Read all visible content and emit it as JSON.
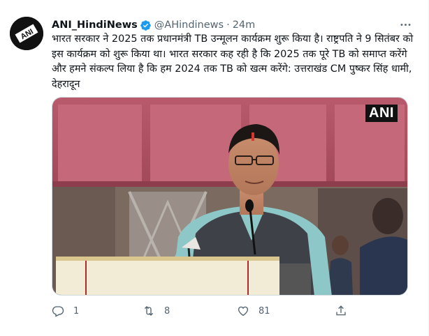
{
  "tweet": {
    "display_name": "ANI_HindiNews",
    "verified_icon": "verified-badge-icon",
    "handle": "@AHindinews",
    "separator": "·",
    "time": "24m",
    "more_icon": "more-options-icon",
    "text": "भारत सरकार ने 2025 तक प्रधानमंत्री TB उन्मूलन कार्यक्रम शुरू किया है। राष्ट्रपति ने 9 सितंबर को इस कार्यक्रम को शुरू किया था। भारत सरकार कह रही है कि 2025 तक पूरे TB को समाप्त करेंगे और हमने संकल्प लिया है कि हम 2024 तक TB को खत्म करेंगे: उत्तराखंड CM पुष्कर सिंह धामी, देहरादून",
    "avatar_logo_text": "ANI",
    "media": {
      "watermark": "ANI"
    },
    "actions": {
      "reply": {
        "icon": "reply-icon",
        "count": "1"
      },
      "retweet": {
        "icon": "retweet-icon",
        "count": "8"
      },
      "like": {
        "icon": "like-heart-icon",
        "count": "81"
      },
      "share": {
        "icon": "share-icon"
      }
    }
  },
  "colors": {
    "text_primary": "#0f1419",
    "text_secondary": "#536471",
    "verified_blue": "#1d9bf0",
    "border": "#cfd9de"
  }
}
